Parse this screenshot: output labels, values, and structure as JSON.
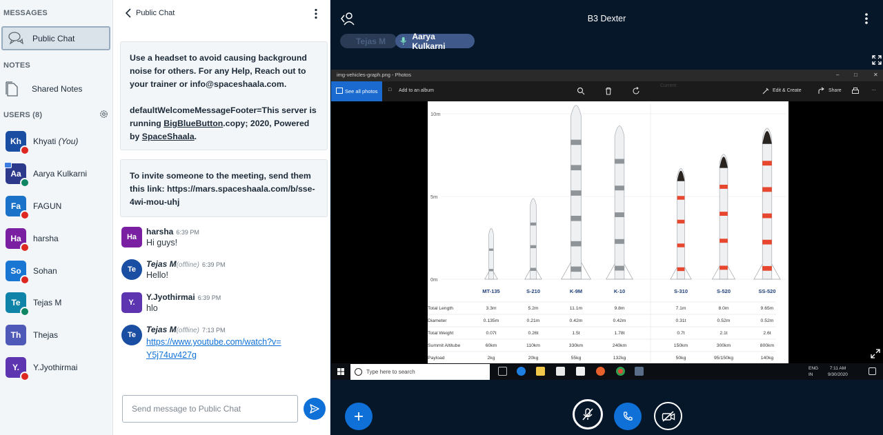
{
  "sidebar": {
    "messages_title": "MESSAGES",
    "public_chat_label": "Public Chat",
    "notes_title": "NOTES",
    "shared_notes_label": "Shared Notes",
    "users_title": "USERS (8)",
    "users": [
      {
        "initials": "Kh",
        "name": "Khyati",
        "suffix": "(You)",
        "color": "#1a4ea3",
        "status": "muted"
      },
      {
        "initials": "Aa",
        "name": "Aarya Kulkarni",
        "suffix": "",
        "color": "#2d3a8c",
        "status": "voice"
      },
      {
        "initials": "Fa",
        "name": "FAGUN",
        "suffix": "",
        "color": "#1a73c9",
        "status": "muted"
      },
      {
        "initials": "Ha",
        "name": "harsha",
        "suffix": "",
        "color": "#7b1fa2",
        "status": "muted"
      },
      {
        "initials": "So",
        "name": "Sohan",
        "suffix": "",
        "color": "#1976d2",
        "status": "muted"
      },
      {
        "initials": "Te",
        "name": "Tejas M",
        "suffix": "",
        "color": "#0f83a8",
        "status": "voice"
      },
      {
        "initials": "Th",
        "name": "Thejas",
        "suffix": "",
        "color": "#4f5ab8",
        "status": "none"
      },
      {
        "initials": "Y.",
        "name": "Y.Jyothirmai",
        "suffix": "",
        "color": "#5e35b1",
        "status": "muted"
      }
    ]
  },
  "chat": {
    "title": "Public Chat",
    "welcome_text": "Use a headset to avoid causing background noise for others. For any Help, Reach out to your trainer or info@spaceshaala.com.",
    "footer_prefix": "defaultWelcomeMessageFooter=This server is running ",
    "footer_link": "BigBlueButton",
    "footer_mid": ".copy; 2020, Powered by ",
    "footer_link2": "SpaceShaala",
    "footer_end": ".",
    "invite_text": "To invite someone to the meeting, send them this link: https://mars.spaceshaala.com/b/sse-4wi-mou-uhj",
    "messages": [
      {
        "initials": "Ha",
        "name": "harsha",
        "status": "",
        "time": "6:39 PM",
        "text": "Hi guys!",
        "color": "#7b1fa2"
      },
      {
        "initials": "Te",
        "name": "Tejas M",
        "status": "(offline)",
        "time": "6:39 PM",
        "text": "Hello!",
        "color": "#1a4ea3"
      },
      {
        "initials": "Y.",
        "name": "Y.Jyothirmai",
        "status": "",
        "time": "6:39 PM",
        "text": "hlo",
        "color": "#5e35b1"
      },
      {
        "initials": "Te",
        "name": "Tejas M",
        "status": "(offline)",
        "time": "7:13 PM",
        "text": "https://www.youtube.com/watch?v=Y5j74uv427g",
        "color": "#1a4ea3"
      }
    ],
    "input_placeholder": "Send message to Public Chat"
  },
  "stage": {
    "meeting_title": "B3 Dexter",
    "talkers": [
      "Tejas M",
      "Aarya Kulkarni"
    ],
    "window_title": "img-vehicles-graph.png - Photos",
    "see_all_photos": "See all photos",
    "add_to_album": "Add to an album",
    "edit_create": "Edit & Create",
    "share": "Share",
    "search_placeholder": "Type here to search",
    "lang": "ENG",
    "region": "IN",
    "clock_time": "7:11 AM",
    "clock_date": "9/30/2020",
    "faded_toolbar_text": "Current"
  },
  "rocket_chart": {
    "y_ticks": [
      "10m",
      "5m",
      "0m"
    ],
    "vehicles": [
      "MT-135",
      "S-210",
      "K-9M",
      "K-10",
      "S-310",
      "S-520",
      "SS-520"
    ],
    "rows": [
      {
        "label": "Total Length",
        "values": [
          "3.3m",
          "5.2m",
          "11.1m",
          "9.8m",
          "7.1m",
          "8.0m",
          "9.65m"
        ]
      },
      {
        "label": "Diameter",
        "values": [
          "0.135m",
          "0.21m",
          "0.42m",
          "0.42m",
          "0.31t",
          "0.52m",
          "0.52m"
        ]
      },
      {
        "label": "Total Weight",
        "values": [
          "0.07t",
          "0.26t",
          "1.5t",
          "1.78t",
          "0.7t",
          "2.1t",
          "2.6t"
        ]
      },
      {
        "label": "Summit Altitube",
        "values": [
          "60km",
          "110km",
          "330km",
          "240km",
          "150km",
          "300km",
          "800km"
        ]
      },
      {
        "label": "Payload",
        "values": [
          "2kg",
          "20kg",
          "55kg",
          "132kg",
          "50kg",
          "95/150kg",
          "140kg"
        ]
      }
    ],
    "heights_m": [
      3.3,
      5.2,
      11.1,
      9.8,
      7.1,
      8.0,
      9.65
    ]
  },
  "colors": {
    "accent": "#0f70d7",
    "muted": "#df2721",
    "voice": "#0e8563",
    "stage_bg": "#06172a"
  }
}
